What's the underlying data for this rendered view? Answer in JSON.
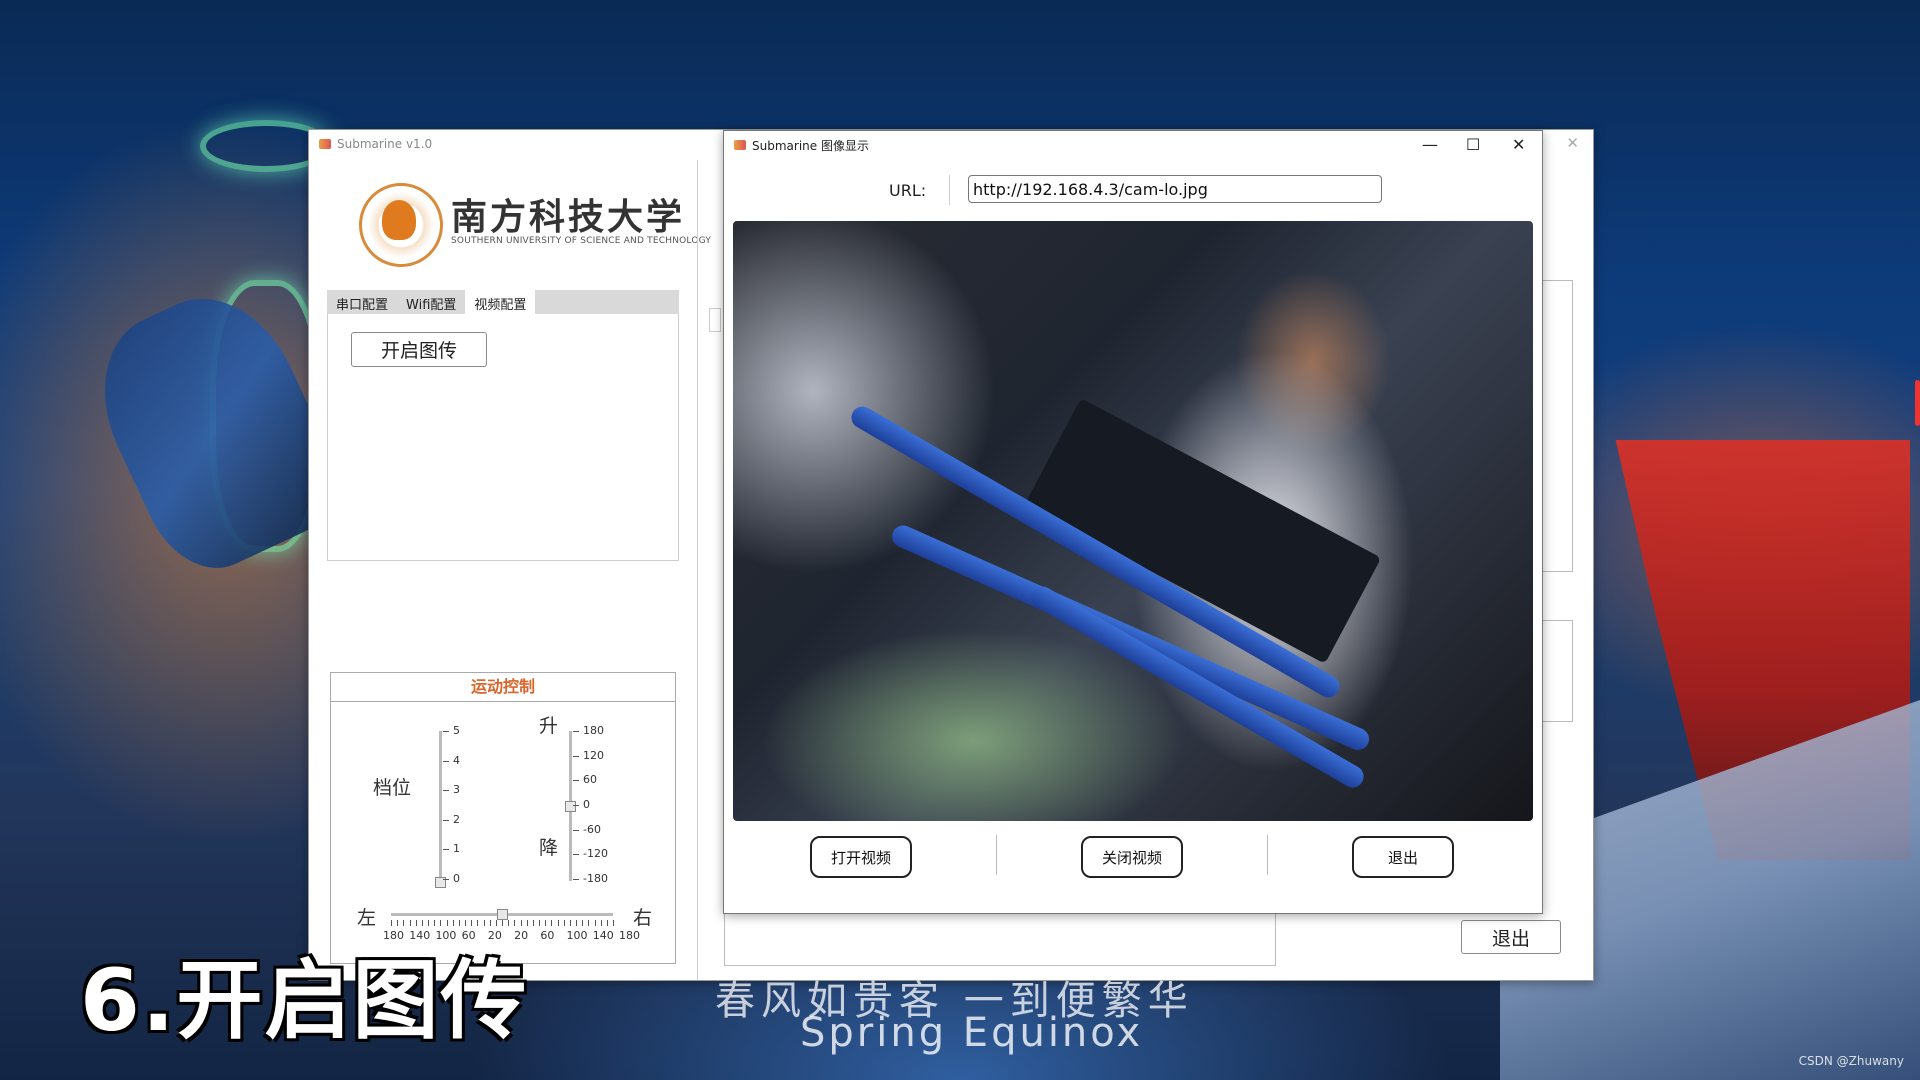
{
  "main_window": {
    "title": "Submarine v1.0",
    "close_glyph": "✕",
    "logo_icon": "university-seal-icon",
    "university_cn": "南方科技大学",
    "university_en": "SOUTHERN UNIVERSITY OF SCIENCE AND TECHNOLOGY",
    "tabs": [
      {
        "label": "串口配置",
        "active": false
      },
      {
        "label": "Wifi配置",
        "active": false
      },
      {
        "label": "视频配置",
        "active": true
      }
    ],
    "open_stream_button": "开启图传",
    "motion": {
      "title": "运动控制",
      "gear_label": "档位",
      "gear_ticks": [
        "5",
        "4",
        "3",
        "2",
        "1",
        "0"
      ],
      "gear_value": 0,
      "up_label": "升",
      "down_label": "降",
      "pitch_ticks": [
        "180",
        "120",
        "60",
        "0",
        "-60",
        "-120",
        "-180"
      ],
      "pitch_value": 0,
      "left_label": "左",
      "right_label": "右",
      "steer_ticks": [
        "180",
        "140",
        "100",
        "60",
        "20",
        "20",
        "60",
        "100",
        "140",
        "180"
      ],
      "steer_value": 0
    },
    "exit_button": "退出"
  },
  "image_window": {
    "title": "Submarine 图像显示",
    "minimize_glyph": "—",
    "maximize_glyph": "☐",
    "close_glyph": "✕",
    "url_label": "URL:",
    "url_value": "http://192.168.4.3/cam-lo.jpg",
    "open_video_button": "打开视频",
    "close_video_button": "关闭视频",
    "exit_button": "退出"
  },
  "overlay": {
    "subtitle": "6.开启图传",
    "lyric_cn": "春风如贵客 一到便繁华",
    "lyric_en": "Spring Equinox",
    "watermark": "CSDN @Zhuwany"
  }
}
